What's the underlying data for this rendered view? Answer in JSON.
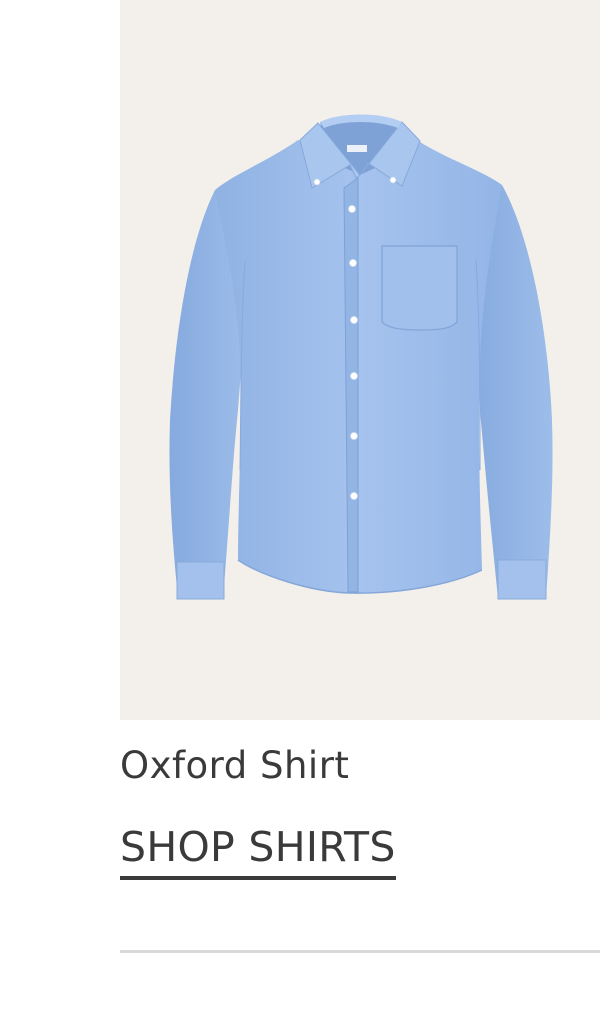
{
  "product": {
    "name": "Oxford Shirt",
    "image_alt": "Blue oxford button-down shirt",
    "cta_label": "SHOP SHIRTS"
  },
  "colors": {
    "panel_background": "#f3f0ec",
    "shirt_blue": "#9dbde9",
    "text": "#3a3a3a",
    "divider": "#d9d9d9"
  }
}
